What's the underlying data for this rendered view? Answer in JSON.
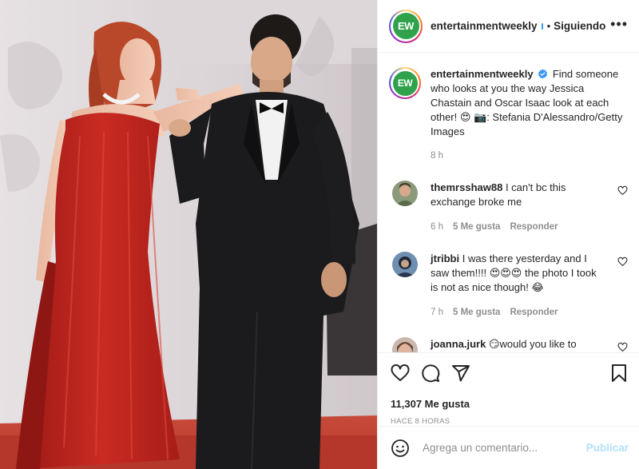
{
  "header": {
    "username": "entertainmentweekly",
    "separator": "•",
    "follow_label": "Siguiendo",
    "more_label": "•••",
    "avatar_text": "EW"
  },
  "caption": {
    "username": "entertainmentweekly",
    "text": "Find someone who looks at you the way Jessica Chastain and Oscar Isaac look at each other! 😍 📷: Stefania D'Alessandro/Getty Images",
    "time": "8 h"
  },
  "comments": [
    {
      "username": "themrsshaw88",
      "text": "I can't bc this exchange broke me",
      "time": "6 h",
      "likes": "5 Me gusta",
      "reply": "Responder"
    },
    {
      "username": "jtribbi",
      "text": "I was there yesterday and I saw them!!!! 😍😍😍 the photo I took is not as nice though! 😂",
      "time": "7 h",
      "likes": "5 Me gusta",
      "reply": "Responder"
    },
    {
      "username": "joanna.jurk",
      "text": "😏would you like to",
      "time": "",
      "likes": "",
      "reply": ""
    }
  ],
  "actions": {
    "likes_count": "11,307 Me gusta",
    "posted_ago": "HACE 8 HORAS",
    "icons": [
      "heart-icon",
      "comment-icon",
      "share-icon",
      "bookmark-icon"
    ]
  },
  "add_comment": {
    "placeholder": "Agrega un comentario...",
    "post_label": "Publicar"
  },
  "colors": {
    "brand_green": "#2fa24b",
    "link_blue_disabled": "#b2dffc",
    "verified_blue": "#3897f0",
    "muted": "#8e8e8e",
    "dress_red": "#b5231d"
  }
}
